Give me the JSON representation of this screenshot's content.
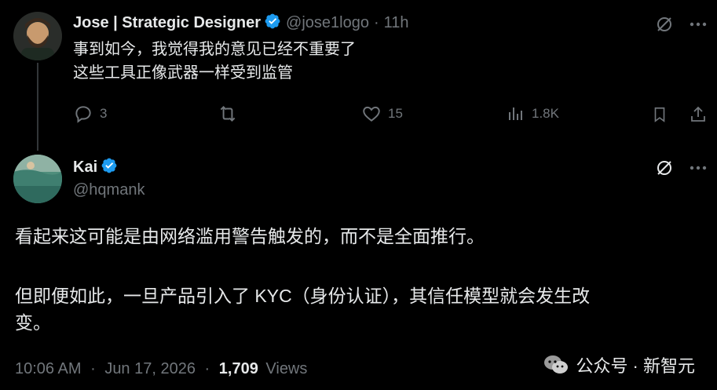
{
  "post1": {
    "author_name": "Jose | Strategic Designer",
    "handle": "@jose1logo",
    "separator": "·",
    "time": "11h",
    "lines": [
      "事到如今，我觉得我的意见已经不重要了",
      "这些工具正像武器一样受到监管"
    ],
    "replies": "3",
    "likes": "15",
    "views": "1.8K"
  },
  "post2": {
    "author_name": "Kai",
    "handle": "@hqmank",
    "paragraph1": "看起来这可能是由网络滥用警告触发的，而不是全面推行。",
    "paragraph2_line1": "但即便如此，一旦产品引入了 KYC（身份认证），其信任模型就会发生改",
    "paragraph2_line2": "变。",
    "time": "10:06 AM",
    "separator": "·",
    "date": "Jun 17, 2026",
    "views_count": "1,709",
    "views_label": "Views"
  },
  "watermark": {
    "text": "公众号 · 新智元"
  },
  "colors": {
    "background": "#000000",
    "text": "#e7e9ea",
    "muted": "#71767b",
    "verified": "#1d9bf0"
  },
  "icons": [
    "verified-icon",
    "grok-icon",
    "more-icon",
    "reply-icon",
    "repost-icon",
    "like-icon",
    "views-icon",
    "bookmark-icon",
    "share-icon",
    "wechat-icon"
  ]
}
